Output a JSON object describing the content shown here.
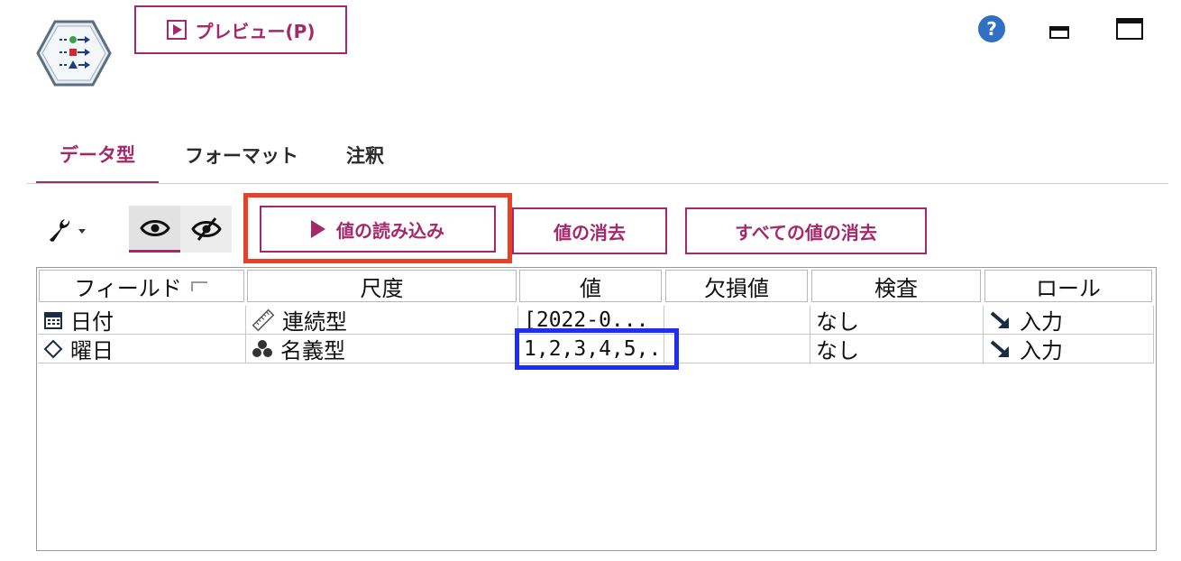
{
  "toolbar": {
    "preview_label": "プレビュー(P)"
  },
  "tabs": [
    {
      "label": "データ型"
    },
    {
      "label": "フォーマット"
    },
    {
      "label": "注釈"
    }
  ],
  "actions": {
    "read_values": "値の読み込み",
    "clear_values": "値の消去",
    "clear_all_values": "すべての値の消去"
  },
  "table": {
    "columns": [
      "フィールド",
      "尺度",
      "値",
      "欠損値",
      "検査",
      "ロール"
    ],
    "rows": [
      {
        "field": "日付",
        "field_icon": "calendar-icon",
        "measure": "連続型",
        "measure_icon": "ruler-icon",
        "value": "[2022-0...",
        "missing": "",
        "check": "なし",
        "role": "入力",
        "role_icon": "arrow-down-right-icon"
      },
      {
        "field": "曜日",
        "field_icon": "diamond-icon",
        "measure": "名義型",
        "measure_icon": "nominal-icon",
        "value": "1,2,3,4,5,...",
        "missing": "",
        "check": "なし",
        "role": "入力",
        "role_icon": "arrow-down-right-icon"
      }
    ]
  },
  "colors": {
    "accent": "#a3296b",
    "highlight_red": "#e8412a",
    "highlight_blue": "#1f2ef0",
    "help_blue": "#2f6fc4"
  }
}
